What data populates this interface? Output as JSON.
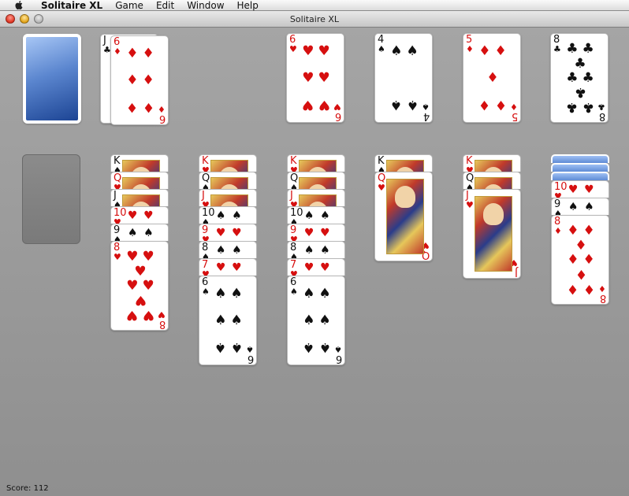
{
  "menubar": {
    "app": "Solitaire XL",
    "items": [
      "Game",
      "Edit",
      "Window",
      "Help"
    ]
  },
  "window": {
    "title": "Solitaire XL"
  },
  "status": {
    "score_label": "Score:",
    "score_value": "112"
  },
  "colors": {
    "felt": "#9b9b9b",
    "red_suit": "#d60f0f",
    "black_suit": "#111111",
    "card_back": "#1c4494"
  },
  "stock": {
    "card": "face-down"
  },
  "waste": {
    "cards": [
      {
        "rank": "J",
        "suit": "♣"
      },
      {
        "rank": "6",
        "suit": "♦"
      }
    ]
  },
  "foundations": [
    {
      "rank": "6",
      "suit": "♥"
    },
    {
      "rank": "4",
      "suit": "♠"
    },
    {
      "rank": "5",
      "suit": "♦"
    },
    {
      "rank": "8",
      "suit": "♣"
    }
  ],
  "tableau": [
    {
      "empty": true
    },
    {
      "cards": [
        {
          "rank": "K",
          "suit": "♠"
        },
        {
          "rank": "Q",
          "suit": "♥"
        },
        {
          "rank": "J",
          "suit": "♠"
        },
        {
          "rank": "10",
          "suit": "♥"
        },
        {
          "rank": "9",
          "suit": "♠"
        },
        {
          "rank": "8",
          "suit": "♥"
        }
      ]
    },
    {
      "cards": [
        {
          "rank": "K",
          "suit": "♥"
        },
        {
          "rank": "Q",
          "suit": "♠"
        },
        {
          "rank": "J",
          "suit": "♥"
        },
        {
          "rank": "10",
          "suit": "♠"
        },
        {
          "rank": "9",
          "suit": "♥"
        },
        {
          "rank": "8",
          "suit": "♠"
        },
        {
          "rank": "7",
          "suit": "♥"
        },
        {
          "rank": "6",
          "suit": "♠"
        }
      ]
    },
    {
      "cards": [
        {
          "rank": "K",
          "suit": "♥"
        },
        {
          "rank": "Q",
          "suit": "♠"
        },
        {
          "rank": "J",
          "suit": "♥"
        },
        {
          "rank": "10",
          "suit": "♠"
        },
        {
          "rank": "9",
          "suit": "♥"
        },
        {
          "rank": "8",
          "suit": "♠"
        },
        {
          "rank": "7",
          "suit": "♥"
        },
        {
          "rank": "6",
          "suit": "♠"
        }
      ]
    },
    {
      "cards": [
        {
          "rank": "K",
          "suit": "♠"
        },
        {
          "rank": "Q",
          "suit": "♥"
        }
      ]
    },
    {
      "cards": [
        {
          "rank": "K",
          "suit": "♥"
        },
        {
          "rank": "Q",
          "suit": "♠"
        },
        {
          "rank": "J",
          "suit": "♥"
        }
      ]
    },
    {
      "facedown": 3,
      "cards": [
        {
          "rank": "10",
          "suit": "♥"
        },
        {
          "rank": "9",
          "suit": "♠"
        },
        {
          "rank": "8",
          "suit": "♦"
        }
      ]
    }
  ]
}
